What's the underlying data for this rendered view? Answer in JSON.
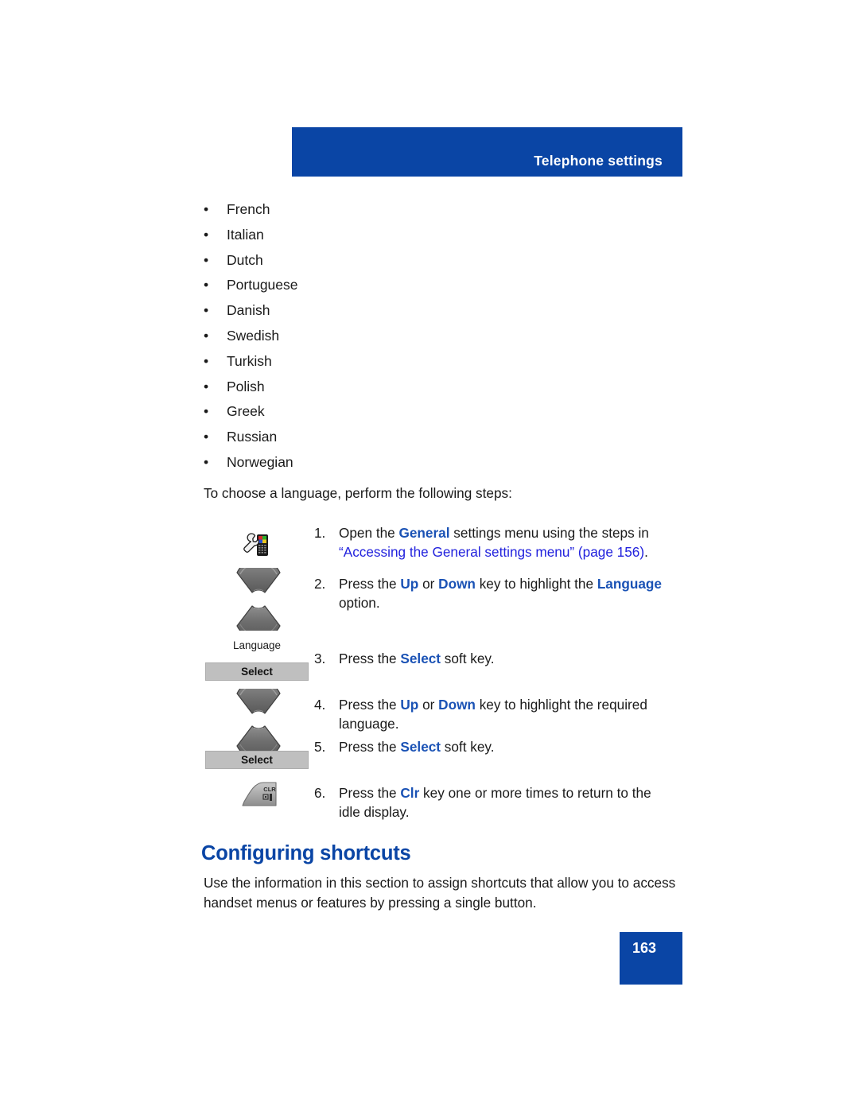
{
  "header": {
    "title": "Telephone settings",
    "banner_color": "#0A45A5"
  },
  "language_list": {
    "bullet": "•",
    "items": [
      "French",
      "Italian",
      "Dutch",
      "Portuguese",
      "Danish",
      "Swedish",
      "Turkish",
      "Polish",
      "Greek",
      "Russian",
      "Norwegian"
    ]
  },
  "intro_paragraph": "To choose a language, perform the following steps:",
  "steps": [
    {
      "number": "1.",
      "icon": "settings-wrench-handset-icon",
      "text_parts": [
        {
          "text": "Open the ",
          "style": "plain"
        },
        {
          "text": "General",
          "style": "keyword"
        },
        {
          "text": " settings menu using the steps in ",
          "style": "plain"
        },
        {
          "text": "“Accessing the General settings menu” (page 156)",
          "style": "xref"
        },
        {
          "text": ".",
          "style": "plain"
        }
      ]
    },
    {
      "number": "2.",
      "icon": "up-down-navigation-key-icon",
      "text_parts": [
        {
          "text": "Press the ",
          "style": "plain"
        },
        {
          "text": "Up",
          "style": "keyword"
        },
        {
          "text": " or ",
          "style": "plain"
        },
        {
          "text": "Down",
          "style": "keyword"
        },
        {
          "text": " key to highlight the ",
          "style": "plain"
        },
        {
          "text": "Language",
          "style": "keyword"
        },
        {
          "text": " option.",
          "style": "plain"
        }
      ]
    },
    {
      "number": "3.",
      "icon": "select-soft-key-icon",
      "text_parts": [
        {
          "text": "Press the ",
          "style": "plain"
        },
        {
          "text": "Select",
          "style": "keyword"
        },
        {
          "text": " soft key.",
          "style": "plain"
        }
      ]
    },
    {
      "number": "4.",
      "icon": "up-down-navigation-key-icon",
      "text_parts": [
        {
          "text": "Press the ",
          "style": "plain"
        },
        {
          "text": "Up",
          "style": "keyword"
        },
        {
          "text": " or ",
          "style": "plain"
        },
        {
          "text": "Down",
          "style": "keyword"
        },
        {
          "text": " key to highlight the required language.",
          "style": "plain"
        }
      ]
    },
    {
      "number": "5.",
      "icon": "select-soft-key-icon",
      "text_parts": [
        {
          "text": "Press the ",
          "style": "plain"
        },
        {
          "text": "Select",
          "style": "keyword"
        },
        {
          "text": " soft key.",
          "style": "plain"
        }
      ]
    },
    {
      "number": "6.",
      "icon": "clr-key-icon",
      "text_parts": [
        {
          "text": "Press the ",
          "style": "plain"
        },
        {
          "text": "Clr",
          "style": "keyword"
        },
        {
          "text": " key one or more times to return to the idle display.",
          "style": "plain"
        }
      ]
    }
  ],
  "softkeys": {
    "language_caption": "Language",
    "select_label_1": "Select",
    "select_label_2": "Select"
  },
  "clr_key": {
    "label": "CLR"
  },
  "section": {
    "heading": "Configuring shortcuts",
    "paragraph": "Use the information in this section to assign shortcuts that allow you to access handset menus or features by pressing a single button."
  },
  "page_number": "163",
  "colors": {
    "brand_blue": "#0A45A5",
    "keyword_blue": "#1A52B5",
    "xref_blue": "#2222DD",
    "softkey_gray": "#BFBFBF"
  }
}
